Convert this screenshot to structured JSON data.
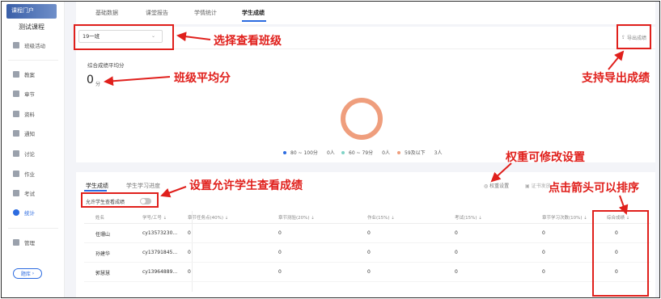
{
  "sidebar": {
    "cover_tag": "课程门户",
    "course_name": "测试课程",
    "items": [
      {
        "label": "班级活动",
        "icon": "grid-icon"
      },
      {
        "label": "教案",
        "icon": "doc-icon"
      },
      {
        "label": "章节",
        "icon": "chapter-icon"
      },
      {
        "label": "资料",
        "icon": "folder-icon"
      },
      {
        "label": "通知",
        "icon": "speaker-icon"
      },
      {
        "label": "讨论",
        "icon": "chat-icon"
      },
      {
        "label": "作业",
        "icon": "edit-icon"
      },
      {
        "label": "考试",
        "icon": "exam-icon"
      },
      {
        "label": "统计",
        "icon": "pie-icon"
      },
      {
        "label": "管理",
        "icon": "gear-icon"
      }
    ],
    "library_button": "题库"
  },
  "tabs": [
    "基础数据",
    "课堂报告",
    "学情统计",
    "学生成绩"
  ],
  "overview": {
    "class_select": "19一班",
    "export_label": "导出成绩",
    "avg_title": "综合成绩平均分",
    "avg_value": "0",
    "avg_unit": "分",
    "legend": [
      {
        "range": "80 ~ 100分",
        "count": "0人",
        "color": "#2c6be0"
      },
      {
        "range": "60 ~ 79分",
        "count": "0人",
        "color": "#7fd3c6"
      },
      {
        "range": "59及以下",
        "count": "3人",
        "color": "#ef9e7d"
      }
    ]
  },
  "scores": {
    "subtabs": [
      "学生成绩",
      "学生学习进度"
    ],
    "allow_label": "允许学生查看成绩",
    "weight_label": "权重设置",
    "cert_label": "证书发放",
    "columns": [
      "姓名",
      "学号/工号",
      "章节任务点(40%)",
      "章节测验(20%)",
      "作业(15%)",
      "考试(15%)",
      "章节学习次数(10%)",
      "综合成绩"
    ],
    "rows": [
      [
        "任珊山",
        "cy13573230...",
        "0",
        "0",
        "0",
        "0",
        "0",
        "0"
      ],
      [
        "孙建华",
        "cy13791845...",
        "0",
        "0",
        "0",
        "0",
        "0",
        "0"
      ],
      [
        "郭慧慧",
        "cy13964889...",
        "0",
        "0",
        "0",
        "0",
        "0",
        "0"
      ]
    ]
  },
  "annotations": {
    "select_class": "选择查看班级",
    "class_avg": "班级平均分",
    "export": "支持导出成绩",
    "weight": "权重可修改设置",
    "allow": "设置允许学生查看成绩",
    "sort": "点击箭头可以排序"
  },
  "colors": {
    "accent": "#2c6be0",
    "annotation": "#e0201c",
    "donut": "#ef9e7d"
  }
}
